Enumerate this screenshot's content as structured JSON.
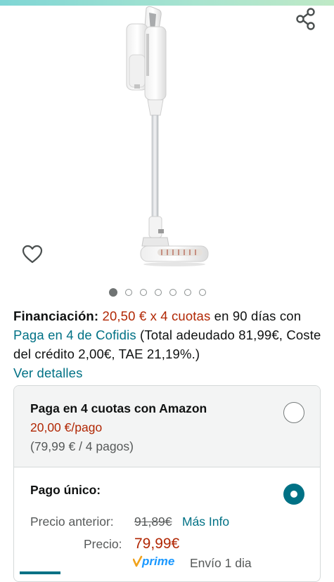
{
  "colors": {
    "price_red": "#b12704",
    "link_teal": "#007185",
    "text_dark": "#0f1111",
    "text_gray": "#565959",
    "prime_blue": "#1a98ff"
  },
  "icons": {
    "share": "share-icon",
    "wishlist": "heart-outline-icon"
  },
  "carousel": {
    "total": 7,
    "active_index": 0
  },
  "financing": {
    "label": "Financiación:",
    "amount": "20,50 € x 4 cuotas",
    "period": " en 90 días con ",
    "provider": "Paga en 4 de Cofidis",
    "terms": " (Total adeudado 81,99€, Coste del crédito 2,00€, TAE 21,19%.)",
    "details_link": "Ver detalles"
  },
  "payment_options": {
    "installments": {
      "title": "Paga en 4 cuotas con Amazon",
      "price": "20,00 €/pago",
      "subtitle": "(79,99 € / 4 pagos)",
      "selected": false
    },
    "single": {
      "title": "Pago único:",
      "selected": true,
      "previous_price_label": "Precio anterior:",
      "previous_price": "91,89€",
      "more_info": "Más Info",
      "price_label": "Precio:",
      "price": "79,99€",
      "prime_badge": "prime",
      "shipping": "Envío 1 dia"
    }
  }
}
